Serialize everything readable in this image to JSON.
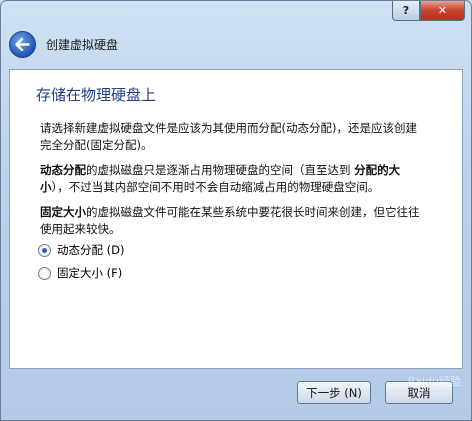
{
  "titlebar": {
    "help_label": "?",
    "close_label": "✕"
  },
  "header": {
    "title": "创建虚拟硬盘",
    "back_icon": "back-arrow-icon"
  },
  "page": {
    "title": "存储在物理硬盘上",
    "para1_line1": "请选择新建虚拟硬盘文件是应该为其使用而分配(动态分配)，还是应该创建",
    "para1_line2": "完全分配(固定分配)。",
    "para2_bold1": "动态分配",
    "para2_text1": "的虚拟磁盘只是逐渐占用物理硬盘的空间（直至达到 ",
    "para2_bold2": "分配的大",
    "para2_bold3": "小",
    "para2_text2": "），不过当其内部空间不用时不会自动缩减占用的物理硬盘空间。",
    "para3_bold": "固定大小",
    "para3_text": "的虚拟磁盘文件可能在某些系统中要花很长时间来创建，但它往往",
    "para3_line2": "使用起来较快。",
    "options": [
      {
        "label": "动态分配 (D)",
        "checked": true
      },
      {
        "label": "固定大小 (F)",
        "checked": false
      }
    ]
  },
  "footer": {
    "next_label": "下一步 (N)",
    "cancel_label": "取消"
  },
  "watermark": "Baidu经验"
}
